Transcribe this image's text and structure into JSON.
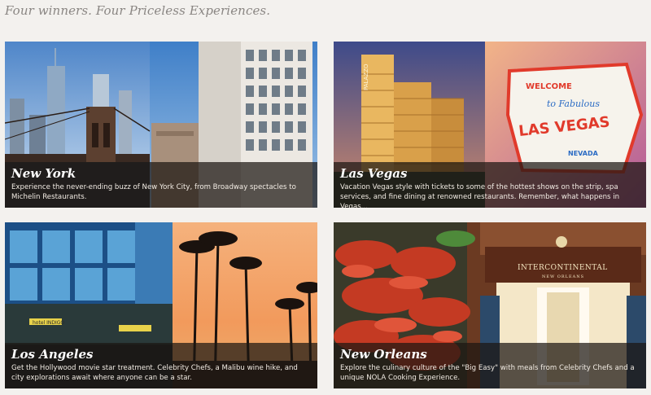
{
  "headline": "Four winners. Four Priceless Experiences.",
  "cards": [
    {
      "city": "New York",
      "description": "Experience the never-ending buzz of New York City, from Broadway spectacles to Michelin Restaurants."
    },
    {
      "city": "Las Vegas",
      "description": "Vacation Vegas style with tickets to some of the hottest shows on the strip, spa services, and fine dining at renowned restaurants. Remember, what happens in Vegas...",
      "sign_text": {
        "welcome": "WELCOME",
        "to": "to Fabulous",
        "main": "LAS VEGAS",
        "state": "NEVADA"
      },
      "hotel_sign": "PALAZZO"
    },
    {
      "city": "Los Angeles",
      "description": "Get the Hollywood movie star treatment. Celebrity Chefs, a Malibu wine hike, and city explorations await where anyone can be a star.",
      "hotel_sign": "hotel INDIGO"
    },
    {
      "city": "New Orleans",
      "description": "Explore the culinary culture of the \"Big Easy\" with meals from Celebrity Chefs and a unique NOLA Cooking Experience.",
      "hotel_sign": "INTERCONTINENTAL",
      "hotel_sub": "NEW ORLEANS"
    }
  ]
}
